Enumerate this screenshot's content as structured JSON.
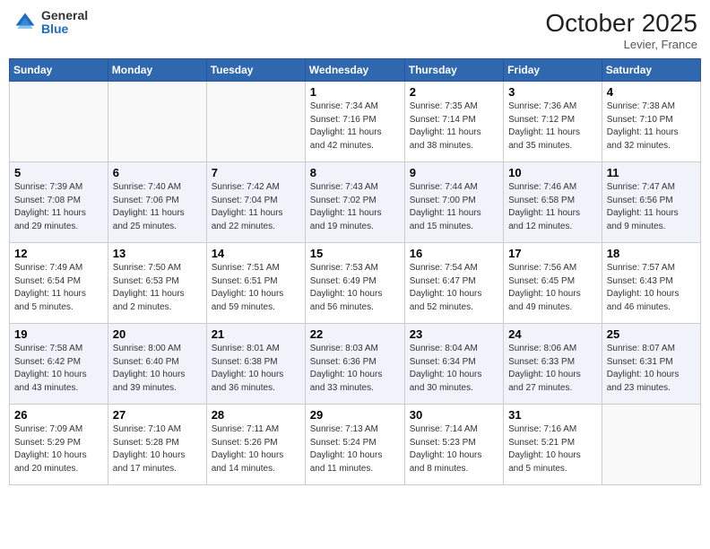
{
  "header": {
    "logo_general": "General",
    "logo_blue": "Blue",
    "month": "October 2025",
    "location": "Levier, France"
  },
  "days_of_week": [
    "Sunday",
    "Monday",
    "Tuesday",
    "Wednesday",
    "Thursday",
    "Friday",
    "Saturday"
  ],
  "weeks": [
    [
      {
        "day": "",
        "info": ""
      },
      {
        "day": "",
        "info": ""
      },
      {
        "day": "",
        "info": ""
      },
      {
        "day": "1",
        "info": "Sunrise: 7:34 AM\nSunset: 7:16 PM\nDaylight: 11 hours\nand 42 minutes."
      },
      {
        "day": "2",
        "info": "Sunrise: 7:35 AM\nSunset: 7:14 PM\nDaylight: 11 hours\nand 38 minutes."
      },
      {
        "day": "3",
        "info": "Sunrise: 7:36 AM\nSunset: 7:12 PM\nDaylight: 11 hours\nand 35 minutes."
      },
      {
        "day": "4",
        "info": "Sunrise: 7:38 AM\nSunset: 7:10 PM\nDaylight: 11 hours\nand 32 minutes."
      }
    ],
    [
      {
        "day": "5",
        "info": "Sunrise: 7:39 AM\nSunset: 7:08 PM\nDaylight: 11 hours\nand 29 minutes."
      },
      {
        "day": "6",
        "info": "Sunrise: 7:40 AM\nSunset: 7:06 PM\nDaylight: 11 hours\nand 25 minutes."
      },
      {
        "day": "7",
        "info": "Sunrise: 7:42 AM\nSunset: 7:04 PM\nDaylight: 11 hours\nand 22 minutes."
      },
      {
        "day": "8",
        "info": "Sunrise: 7:43 AM\nSunset: 7:02 PM\nDaylight: 11 hours\nand 19 minutes."
      },
      {
        "day": "9",
        "info": "Sunrise: 7:44 AM\nSunset: 7:00 PM\nDaylight: 11 hours\nand 15 minutes."
      },
      {
        "day": "10",
        "info": "Sunrise: 7:46 AM\nSunset: 6:58 PM\nDaylight: 11 hours\nand 12 minutes."
      },
      {
        "day": "11",
        "info": "Sunrise: 7:47 AM\nSunset: 6:56 PM\nDaylight: 11 hours\nand 9 minutes."
      }
    ],
    [
      {
        "day": "12",
        "info": "Sunrise: 7:49 AM\nSunset: 6:54 PM\nDaylight: 11 hours\nand 5 minutes."
      },
      {
        "day": "13",
        "info": "Sunrise: 7:50 AM\nSunset: 6:53 PM\nDaylight: 11 hours\nand 2 minutes."
      },
      {
        "day": "14",
        "info": "Sunrise: 7:51 AM\nSunset: 6:51 PM\nDaylight: 10 hours\nand 59 minutes."
      },
      {
        "day": "15",
        "info": "Sunrise: 7:53 AM\nSunset: 6:49 PM\nDaylight: 10 hours\nand 56 minutes."
      },
      {
        "day": "16",
        "info": "Sunrise: 7:54 AM\nSunset: 6:47 PM\nDaylight: 10 hours\nand 52 minutes."
      },
      {
        "day": "17",
        "info": "Sunrise: 7:56 AM\nSunset: 6:45 PM\nDaylight: 10 hours\nand 49 minutes."
      },
      {
        "day": "18",
        "info": "Sunrise: 7:57 AM\nSunset: 6:43 PM\nDaylight: 10 hours\nand 46 minutes."
      }
    ],
    [
      {
        "day": "19",
        "info": "Sunrise: 7:58 AM\nSunset: 6:42 PM\nDaylight: 10 hours\nand 43 minutes."
      },
      {
        "day": "20",
        "info": "Sunrise: 8:00 AM\nSunset: 6:40 PM\nDaylight: 10 hours\nand 39 minutes."
      },
      {
        "day": "21",
        "info": "Sunrise: 8:01 AM\nSunset: 6:38 PM\nDaylight: 10 hours\nand 36 minutes."
      },
      {
        "day": "22",
        "info": "Sunrise: 8:03 AM\nSunset: 6:36 PM\nDaylight: 10 hours\nand 33 minutes."
      },
      {
        "day": "23",
        "info": "Sunrise: 8:04 AM\nSunset: 6:34 PM\nDaylight: 10 hours\nand 30 minutes."
      },
      {
        "day": "24",
        "info": "Sunrise: 8:06 AM\nSunset: 6:33 PM\nDaylight: 10 hours\nand 27 minutes."
      },
      {
        "day": "25",
        "info": "Sunrise: 8:07 AM\nSunset: 6:31 PM\nDaylight: 10 hours\nand 23 minutes."
      }
    ],
    [
      {
        "day": "26",
        "info": "Sunrise: 7:09 AM\nSunset: 5:29 PM\nDaylight: 10 hours\nand 20 minutes."
      },
      {
        "day": "27",
        "info": "Sunrise: 7:10 AM\nSunset: 5:28 PM\nDaylight: 10 hours\nand 17 minutes."
      },
      {
        "day": "28",
        "info": "Sunrise: 7:11 AM\nSunset: 5:26 PM\nDaylight: 10 hours\nand 14 minutes."
      },
      {
        "day": "29",
        "info": "Sunrise: 7:13 AM\nSunset: 5:24 PM\nDaylight: 10 hours\nand 11 minutes."
      },
      {
        "day": "30",
        "info": "Sunrise: 7:14 AM\nSunset: 5:23 PM\nDaylight: 10 hours\nand 8 minutes."
      },
      {
        "day": "31",
        "info": "Sunrise: 7:16 AM\nSunset: 5:21 PM\nDaylight: 10 hours\nand 5 minutes."
      },
      {
        "day": "",
        "info": ""
      }
    ]
  ]
}
